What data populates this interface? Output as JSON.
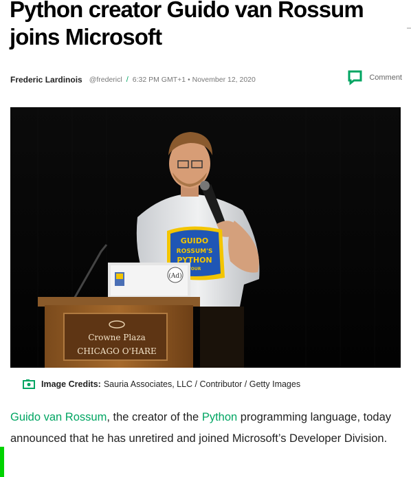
{
  "article": {
    "headline": "Python creator Guido van Rossum joins Microsoft",
    "author": "Frederic Lardinois",
    "handle": "@fredericl",
    "separator": "/",
    "time": "6:32 PM GMT+1",
    "dot": "•",
    "date": "November 12, 2020",
    "comment_label": "Comment"
  },
  "image": {
    "credits_label": "Image Credits:",
    "credits_text": "Sauria Associates, LLC / Contributor / Getty Images",
    "podium_sign_line1": "Crowne Plaza",
    "podium_sign_line2": "CHICAGO O'HARE",
    "shirt_text": [
      "GUIDO",
      "ROSSUM'S",
      "PYTHON",
      "TOUR"
    ],
    "laptop_sticker": "(Ad)"
  },
  "body": {
    "link1": "Guido van Rossum",
    "text1": ", the creator of the ",
    "link2": "Python",
    "text2": " programming language, today announced that he has unretired and joined Microsoft’s Developer Division."
  },
  "colors": {
    "accent": "#00a562",
    "highlight_bar": "#00d300"
  },
  "icons": {
    "comment": "comment-icon",
    "camera": "camera-icon"
  }
}
